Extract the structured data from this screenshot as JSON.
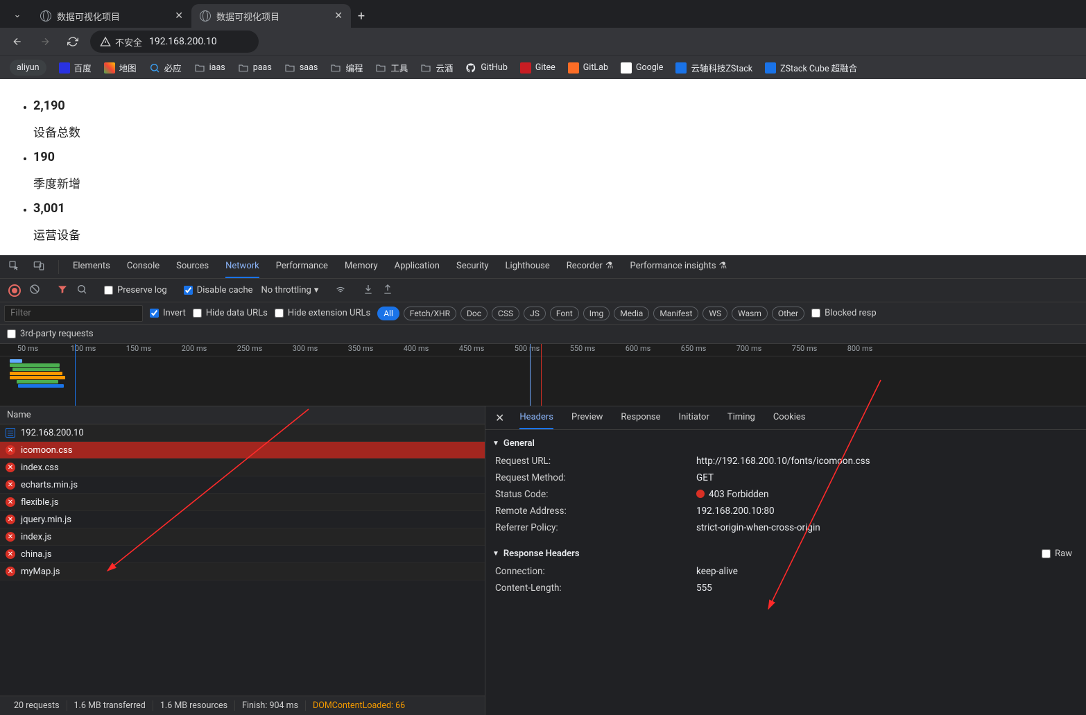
{
  "browser": {
    "tabs": [
      {
        "title": "数据可视化项目",
        "active": false
      },
      {
        "title": "数据可视化项目",
        "active": true
      }
    ],
    "security_label": "不安全",
    "url": "192.168.200.10",
    "bookmarks": [
      {
        "label": "aliyun",
        "icon": "text"
      },
      {
        "label": "百度",
        "icon": "baidu",
        "color": "#2932e1"
      },
      {
        "label": "地图",
        "icon": "map"
      },
      {
        "label": "必应",
        "icon": "search",
        "color": "#3ba3f8"
      },
      {
        "label": "iaas",
        "icon": "folder"
      },
      {
        "label": "paas",
        "icon": "folder"
      },
      {
        "label": "saas",
        "icon": "folder"
      },
      {
        "label": "编程",
        "icon": "folder"
      },
      {
        "label": "工具",
        "icon": "folder"
      },
      {
        "label": "云酒",
        "icon": "folder"
      },
      {
        "label": "GitHub",
        "icon": "github"
      },
      {
        "label": "Gitee",
        "icon": "gitee",
        "color": "#c71d23"
      },
      {
        "label": "GitLab",
        "icon": "gitlab",
        "color": "#fc6d26"
      },
      {
        "label": "Google",
        "icon": "google"
      },
      {
        "label": "云轴科技ZStack",
        "icon": "zstack",
        "color": "#1a73e8"
      },
      {
        "label": "ZStack Cube 超融合",
        "icon": "zstack2",
        "color": "#1a73e8"
      }
    ]
  },
  "page": {
    "items": [
      {
        "value": "2,190",
        "label": "设备总数"
      },
      {
        "value": "190",
        "label": "季度新增"
      },
      {
        "value": "3,001",
        "label": "运营设备"
      }
    ]
  },
  "devtools": {
    "panels": [
      "Elements",
      "Console",
      "Sources",
      "Network",
      "Performance",
      "Memory",
      "Application",
      "Security",
      "Lighthouse",
      "Recorder",
      "Performance insights"
    ],
    "active_panel": "Network",
    "toolbar": {
      "preserve_log": "Preserve log",
      "preserve_log_checked": false,
      "disable_cache": "Disable cache",
      "disable_cache_checked": true,
      "throttling": "No throttling"
    },
    "filter": {
      "placeholder": "Filter",
      "invert": "Invert",
      "invert_checked": true,
      "hide_data": "Hide data URLs",
      "hide_ext": "Hide extension URLs",
      "types": [
        "All",
        "Fetch/XHR",
        "Doc",
        "CSS",
        "JS",
        "Font",
        "Img",
        "Media",
        "Manifest",
        "WS",
        "Wasm",
        "Other"
      ],
      "active_type": "All",
      "blocked": "Blocked resp",
      "third_party": "3rd-party requests"
    },
    "timeline_labels": [
      "50 ms",
      "100 ms",
      "150 ms",
      "200 ms",
      "250 ms",
      "300 ms",
      "350 ms",
      "400 ms",
      "450 ms",
      "500 ms",
      "550 ms",
      "600 ms",
      "650 ms",
      "700 ms",
      "750 ms",
      "800 ms"
    ],
    "name_header": "Name",
    "requests": [
      {
        "name": "192.168.200.10",
        "status": "doc"
      },
      {
        "name": "icomoon.css",
        "status": "error",
        "selected": true
      },
      {
        "name": "index.css",
        "status": "error"
      },
      {
        "name": "echarts.min.js",
        "status": "error"
      },
      {
        "name": "flexible.js",
        "status": "error"
      },
      {
        "name": "jquery.min.js",
        "status": "error"
      },
      {
        "name": "index.js",
        "status": "error"
      },
      {
        "name": "china.js",
        "status": "error"
      },
      {
        "name": "myMap.js",
        "status": "error"
      }
    ],
    "status_bar": {
      "requests": "20 requests",
      "transferred": "1.6 MB transferred",
      "resources": "1.6 MB resources",
      "finish": "Finish: 904 ms",
      "dcl": "DOMContentLoaded: 66"
    },
    "detail": {
      "tabs": [
        "Headers",
        "Preview",
        "Response",
        "Initiator",
        "Timing",
        "Cookies"
      ],
      "active_tab": "Headers",
      "general_label": "General",
      "general": [
        {
          "k": "Request URL:",
          "v": "http://192.168.200.10/fonts/icomoon.css"
        },
        {
          "k": "Request Method:",
          "v": "GET"
        },
        {
          "k": "Status Code:",
          "v": "403 Forbidden",
          "dot": true
        },
        {
          "k": "Remote Address:",
          "v": "192.168.200.10:80"
        },
        {
          "k": "Referrer Policy:",
          "v": "strict-origin-when-cross-origin"
        }
      ],
      "response_headers_label": "Response Headers",
      "raw_label": "Raw",
      "response_headers": [
        {
          "k": "Connection:",
          "v": "keep-alive"
        },
        {
          "k": "Content-Length:",
          "v": "555"
        }
      ]
    }
  }
}
